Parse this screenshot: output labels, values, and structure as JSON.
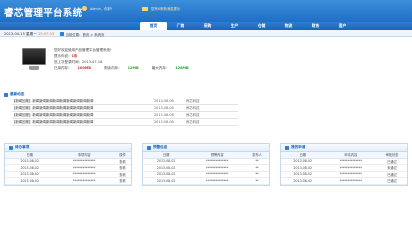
{
  "header": {
    "logo": "睿芯管理平台系统",
    "user": "Admin，你好!",
    "messages": "您有6条新消息提示"
  },
  "nav": {
    "tabs": [
      "首页",
      "厂商",
      "采购",
      "生产",
      "仓储",
      "物流",
      "财务",
      "客户"
    ],
    "active_index": 0
  },
  "datebar": {
    "date": "2013-04-15  星期一",
    "time": "15:07:33",
    "breadcrumb": "当前位置：首页 > 系统页"
  },
  "welcome": {
    "line1": "您好欢迎使用产品管理平台管理系统!",
    "line2_label": "提示你说：",
    "line2_value": "1条",
    "line3": "您上次登录时间：2013-07-16",
    "stats": [
      {
        "label": "已用内存：",
        "value": "100MB"
      },
      {
        "label": "剩余内存：",
        "value": "12MB"
      },
      {
        "label": "最大内存：",
        "value": "128MB"
      }
    ]
  },
  "news": {
    "title": "最新动态",
    "items": [
      {
        "text": "【新闻回报】新闻新闻新闻新闻新闻新闻新闻新闻新闻",
        "date": "2013-08-08",
        "source": "睿芯科技"
      },
      {
        "text": "【新闻回报】新闻新闻新闻新闻新闻新闻新闻新闻新闻",
        "date": "2013-08-08",
        "source": "睿芯科技"
      },
      {
        "text": "【新闻回报】新闻新闻新闻新闻新闻新闻新闻新闻新闻",
        "date": "2013-08-08",
        "source": "睿芯科技"
      },
      {
        "text": "【新闻回报】新闻新闻新闻新闻新闻新闻新闻新闻新闻",
        "date": "2013-08-08",
        "source": "睿芯科技"
      }
    ]
  },
  "panels": [
    {
      "title": "待办事项",
      "columns": [
        "日期",
        "事项内容",
        "操作"
      ],
      "rows": [
        [
          "2013-08-02",
          "**************",
          "查看"
        ],
        [
          "2013-08-02",
          "**************",
          "查看"
        ],
        [
          "2013-08-02",
          "**************",
          "查看"
        ],
        [
          "2013-08-02",
          "**************",
          "查看"
        ]
      ]
    },
    {
      "title": "预警信息",
      "columns": [
        "日期",
        "预警内容",
        "发布人"
      ],
      "rows": [
        [
          "2013-08-02",
          "**************",
          "**"
        ],
        [
          "2013-08-02",
          "**************",
          "**"
        ],
        [
          "2013-08-02",
          "**************",
          "**"
        ],
        [
          "2013-08-02",
          "**************",
          "**"
        ]
      ]
    },
    {
      "title": "我的申请",
      "columns": [
        "日期",
        "申请内容",
        "审批状态"
      ],
      "rows": [
        [
          "2013-08-02",
          "**************",
          "已通过"
        ],
        [
          "2013-08-02",
          "**************",
          "未通过"
        ],
        [
          "2013-08-02",
          "**************",
          "已通过"
        ],
        [
          "2013-08-02",
          "**************",
          "已通过"
        ]
      ]
    }
  ],
  "colors": {
    "brand": "#1f6ec6",
    "approved": "#2aa02a",
    "rejected": "#e03b3b"
  }
}
